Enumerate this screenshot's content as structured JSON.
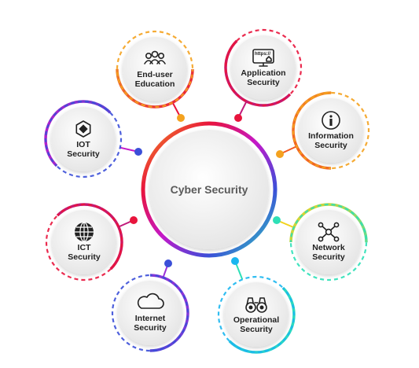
{
  "center": {
    "label": "Cyber Security"
  },
  "nodes": [
    {
      "id": "end-user-education",
      "lines": [
        "End-user",
        "Education"
      ],
      "icon": "users-icon",
      "color_a": "#f4a21f",
      "color_b": "#e8143c"
    },
    {
      "id": "application-security",
      "lines": [
        "Application",
        "Security"
      ],
      "icon": "https-monitor-icon",
      "icon_text": "https://",
      "color_a": "#e8143c",
      "color_b": "#c0197a"
    },
    {
      "id": "information-security",
      "lines": [
        "Information",
        "Security"
      ],
      "icon": "info-icon",
      "color_a": "#f4a21f",
      "color_b": "#f15a22"
    },
    {
      "id": "iot-security",
      "lines": [
        "IOT",
        "Security"
      ],
      "icon": "hexagon-chip-icon",
      "color_a": "#3b4fd8",
      "color_b": "#c418c9"
    },
    {
      "id": "network-security",
      "lines": [
        "Network",
        "Security"
      ],
      "icon": "network-nodes-icon",
      "color_a": "#2ee0b7",
      "color_b": "#f2d21b"
    },
    {
      "id": "ict-security",
      "lines": [
        "ICT",
        "Security"
      ],
      "icon": "globe-icon",
      "color_a": "#e8143c",
      "color_b": "#c0197a"
    },
    {
      "id": "internet-security",
      "lines": [
        "Internet",
        "Security"
      ],
      "icon": "cloud-icon",
      "color_a": "#3b4fd8",
      "color_b": "#9b2fd8"
    },
    {
      "id": "operational-security",
      "lines": [
        "Operational",
        "Security"
      ],
      "icon": "binoculars-icon",
      "color_a": "#1ab6f0",
      "color_b": "#2ee0b7"
    }
  ]
}
